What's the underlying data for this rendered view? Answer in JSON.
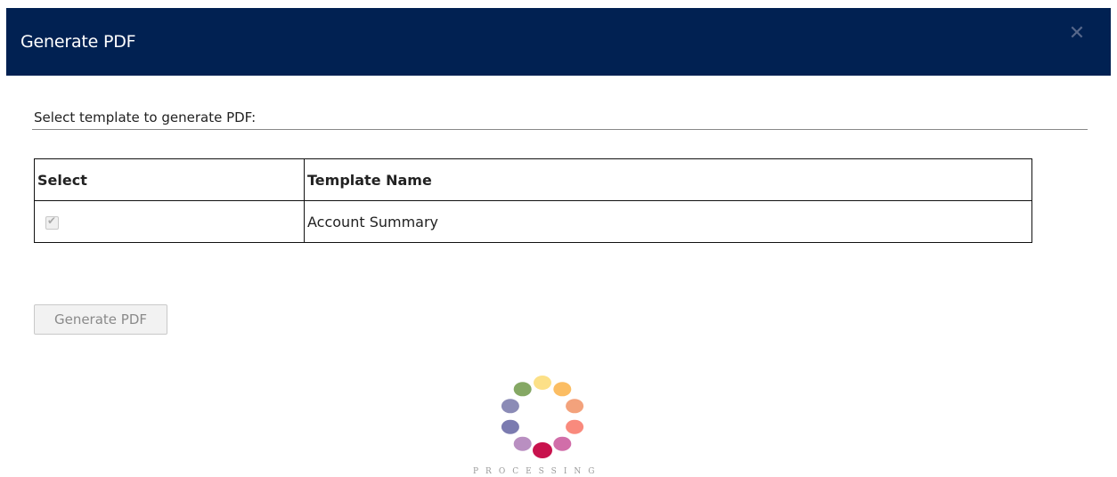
{
  "dialog": {
    "title": "Generate PDF",
    "close_icon": "close-icon",
    "header_color": "#012152"
  },
  "section": {
    "label": "Select template to generate PDF:"
  },
  "table": {
    "headers": [
      "Select",
      "Template Name"
    ],
    "rows": [
      {
        "selected": true,
        "template_name": "Account Summary"
      }
    ]
  },
  "actions": {
    "generate_label": "Generate PDF"
  },
  "loader": {
    "label": "PROCESSING",
    "dot_colors": [
      "#fce087",
      "#fbbd63",
      "#f3a27c",
      "#f98a7d",
      "#d16ea9",
      "#c8124d",
      "#b98fc1",
      "#7b7bb0",
      "#8b8bb6",
      "#85a864"
    ]
  }
}
